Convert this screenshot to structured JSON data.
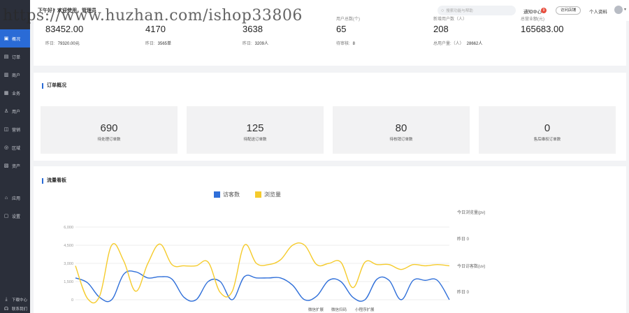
{
  "watermark": "https://www.huzhan.com/ishop33806",
  "sidebar": {
    "items": [
      {
        "label": "概况",
        "icon": "dashboard-icon",
        "glyph": "▣",
        "active": true
      },
      {
        "label": "订单",
        "icon": "order-icon",
        "glyph": "▤",
        "active": false
      },
      {
        "label": "商户",
        "icon": "store-icon",
        "glyph": "▥",
        "active": false
      },
      {
        "label": "业务",
        "icon": "briefcase-icon",
        "glyph": "▦",
        "active": false
      },
      {
        "label": "用户",
        "icon": "user-icon",
        "glyph": "♙",
        "active": false
      },
      {
        "label": "营销",
        "icon": "marketing-icon",
        "glyph": "◫",
        "active": false
      },
      {
        "label": "区域",
        "icon": "region-icon",
        "glyph": "◎",
        "active": false
      },
      {
        "label": "资产",
        "icon": "asset-icon",
        "glyph": "▧",
        "active": false
      }
    ],
    "lower_items": [
      {
        "label": "应用",
        "icon": "app-icon",
        "glyph": "⌂"
      },
      {
        "label": "设置",
        "icon": "settings-icon",
        "glyph": "▢"
      }
    ],
    "bottom_items": [
      {
        "label": "下载中心",
        "icon": "download-icon",
        "glyph": "⤓"
      },
      {
        "label": "联系我们",
        "icon": "headset-icon",
        "glyph": "☊"
      }
    ]
  },
  "header": {
    "greeting": "下午好！欢迎使用，管理员",
    "search_placeholder": "搜索功能与帮助",
    "notice_label": "通知中心",
    "notice_count": "9",
    "visit_store": "访问店铺",
    "profile": "个人资料"
  },
  "stats": [
    {
      "label": "",
      "value": "83452.00",
      "sub_label": "昨日:",
      "sub_value": "79320.00元"
    },
    {
      "label": "",
      "value": "4170",
      "sub_label": "昨日:",
      "sub_value": "3565单"
    },
    {
      "label": "",
      "value": "3638",
      "sub_label": "昨日:",
      "sub_value": "3209人"
    },
    {
      "label": "用户总数(个)",
      "value": "65",
      "sub_label": "待审核:",
      "sub_value": "8"
    },
    {
      "label": "新增用户数（人）",
      "value": "208",
      "sub_label": "总用户量:（人）",
      "sub_value": "28662人"
    },
    {
      "label": "总营业额(元)",
      "value": "165683.00",
      "sub_label": "",
      "sub_value": ""
    }
  ],
  "orders": {
    "title": "订单概况",
    "boxes": [
      {
        "value": "690",
        "label": "待处理订单数"
      },
      {
        "value": "125",
        "label": "待配送订单数"
      },
      {
        "value": "80",
        "label": "待核销订单数"
      },
      {
        "value": "0",
        "label": "售后维权订单数"
      }
    ]
  },
  "traffic": {
    "title": "流量看板",
    "today_pv_label": "今日浏览量(pv)",
    "yesterday_pv": "昨日 0",
    "today_uv_label": "今日访客数(uv)",
    "yesterday_uv": "昨日 0",
    "bottom_labels": [
      "微信扩展",
      "微信扫码",
      "小程序扩展"
    ]
  },
  "chart_data": {
    "type": "line",
    "title": "",
    "xlabel": "",
    "ylabel": "",
    "ylim": [
      0,
      6000
    ],
    "y_ticks": [
      "6,000",
      "4,500",
      "3,000",
      "1,500",
      "0"
    ],
    "x": [
      0,
      1,
      2,
      3,
      4,
      5,
      6,
      7,
      8,
      9,
      10,
      11,
      12,
      13,
      14,
      15,
      16,
      17,
      18,
      19,
      20,
      21,
      22,
      23,
      24,
      25,
      26,
      27,
      28,
      29,
      30,
      31
    ],
    "series": [
      {
        "name": "访客数",
        "color": "#2f6fd9",
        "values": [
          1800,
          1400,
          200,
          0,
          2100,
          2300,
          1800,
          1900,
          1700,
          200,
          0,
          1500,
          1500,
          0,
          1900,
          1800,
          1800,
          1800,
          1200,
          0,
          300,
          1600,
          1500,
          200,
          0,
          1700,
          1600,
          0,
          1600,
          1600,
          1600,
          0
        ]
      },
      {
        "name": "浏览量",
        "color": "#f5cb2c",
        "values": [
          2800,
          100,
          300,
          4500,
          3200,
          700,
          3000,
          4600,
          2900,
          2800,
          2800,
          3100,
          600,
          700,
          4500,
          3000,
          2900,
          3300,
          4500,
          4500,
          2900,
          3000,
          3100,
          1000,
          3100,
          2900,
          2900,
          2500,
          2900,
          2800,
          2900,
          2800
        ]
      }
    ],
    "grid": true,
    "legend": "top-center"
  }
}
